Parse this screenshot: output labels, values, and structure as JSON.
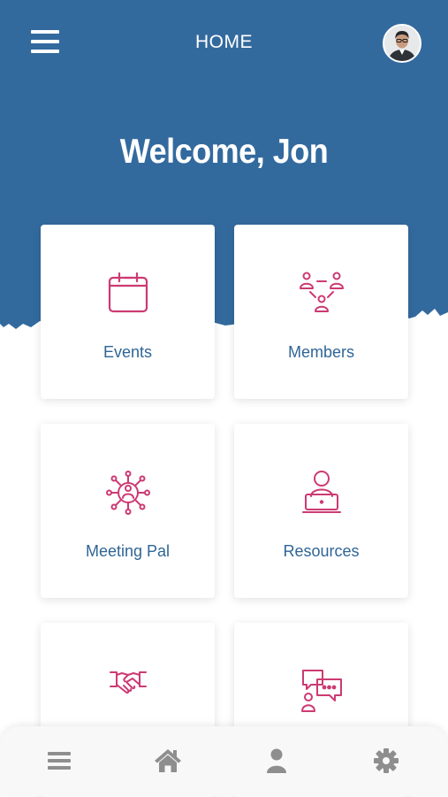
{
  "header": {
    "title": "HOME",
    "menu_icon": "hamburger-icon",
    "avatar_icon": "user-avatar"
  },
  "welcome": "Welcome, Jon",
  "colors": {
    "primary_blue": "#336a9e",
    "accent_pink": "#cc3a73",
    "label_blue": "#2f6596",
    "nav_gray": "#8e8e8e"
  },
  "tiles": [
    {
      "label": "Events",
      "icon": "calendar-icon"
    },
    {
      "label": "Members",
      "icon": "members-network-icon"
    },
    {
      "label": "Meeting Pal",
      "icon": "network-hub-icon"
    },
    {
      "label": "Resources",
      "icon": "person-laptop-icon"
    },
    {
      "label": "",
      "icon": "handshake-icon"
    },
    {
      "label": "",
      "icon": "chat-person-icon"
    }
  ],
  "bottom_nav": [
    {
      "icon": "list-icon"
    },
    {
      "icon": "home-icon"
    },
    {
      "icon": "profile-icon"
    },
    {
      "icon": "settings-gear-icon"
    }
  ]
}
